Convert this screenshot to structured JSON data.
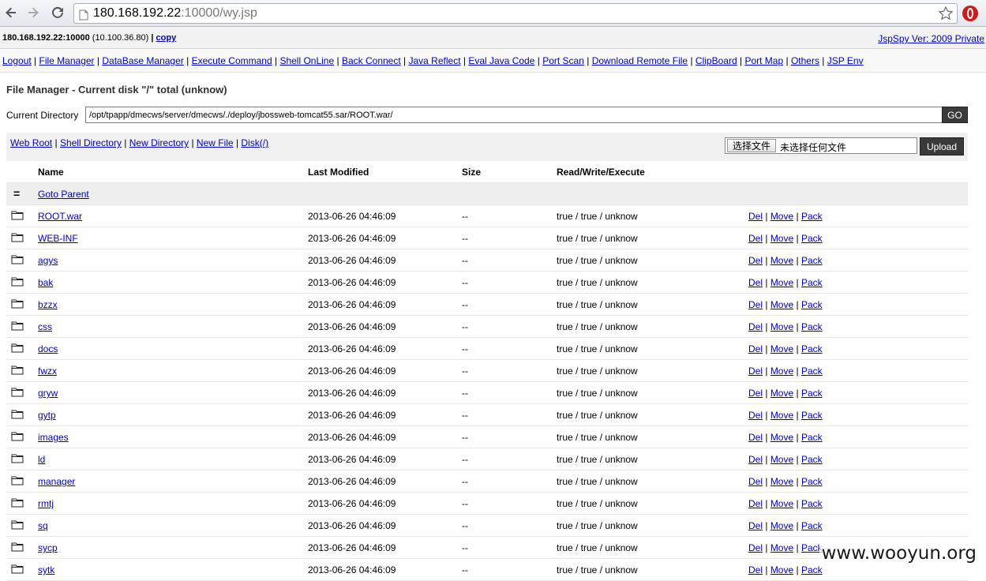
{
  "browser": {
    "url_host": "180.168.192.22",
    "url_rest": ":10000/wy.jsp"
  },
  "info": {
    "host": "180.168.192.22:10000",
    "local_ip": "(10.100.36.80)",
    "copy": "copy",
    "version": "JspSpy Ver: 2009 Private"
  },
  "menu": [
    "Logout",
    "File Manager",
    "DataBase Manager",
    "Execute Command",
    "Shell OnLine",
    "Back Connect",
    "Java Reflect",
    "Eval Java Code",
    "Port Scan",
    "Download Remote File",
    "ClipBoard",
    "Port Map",
    "Others",
    "JSP Env"
  ],
  "file_manager": {
    "title": "File Manager - Current disk \"/\" total (unknow)",
    "current_dir_label": "Current Directory",
    "current_dir_value": "/opt/tpapp/dmecws/server/dmecws/./deploy/jbossweb-tomcat55.sar/ROOT.war/",
    "go_label": "GO",
    "toolbar_links": [
      "Web Root",
      "Shell Directory",
      "New Directory",
      "New File",
      "Disk(/)"
    ],
    "choose_file_label": "选择文件",
    "no_file_label": "未选择任何文件",
    "upload_label": "Upload",
    "columns": {
      "name": "Name",
      "modified": "Last Modified",
      "size": "Size",
      "rwx": "Read/Write/Execute"
    },
    "parent_icon": "=",
    "goto_parent": "Goto Parent",
    "actions": [
      "Del",
      "Move",
      "Pack"
    ],
    "rows": [
      {
        "name": "ROOT.war",
        "modified": "2013-06-26 04:46:09",
        "size": "--",
        "rwx": "true / true / unknow"
      },
      {
        "name": "WEB-INF",
        "modified": "2013-06-26 04:46:09",
        "size": "--",
        "rwx": "true / true / unknow"
      },
      {
        "name": "agys",
        "modified": "2013-06-26 04:46:09",
        "size": "--",
        "rwx": "true / true / unknow"
      },
      {
        "name": "bak",
        "modified": "2013-06-26 04:46:09",
        "size": "--",
        "rwx": "true / true / unknow"
      },
      {
        "name": "bzzx",
        "modified": "2013-06-26 04:46:09",
        "size": "--",
        "rwx": "true / true / unknow"
      },
      {
        "name": "css",
        "modified": "2013-06-26 04:46:09",
        "size": "--",
        "rwx": "true / true / unknow"
      },
      {
        "name": "docs",
        "modified": "2013-06-26 04:46:09",
        "size": "--",
        "rwx": "true / true / unknow"
      },
      {
        "name": "fwzx",
        "modified": "2013-06-26 04:46:09",
        "size": "--",
        "rwx": "true / true / unknow"
      },
      {
        "name": "gryw",
        "modified": "2013-06-26 04:46:09",
        "size": "--",
        "rwx": "true / true / unknow"
      },
      {
        "name": "gytp",
        "modified": "2013-06-26 04:46:09",
        "size": "--",
        "rwx": "true / true / unknow"
      },
      {
        "name": "images",
        "modified": "2013-06-26 04:46:09",
        "size": "--",
        "rwx": "true / true / unknow"
      },
      {
        "name": "ld",
        "modified": "2013-06-26 04:46:09",
        "size": "--",
        "rwx": "true / true / unknow"
      },
      {
        "name": "manager",
        "modified": "2013-06-26 04:46:09",
        "size": "--",
        "rwx": "true / true / unknow"
      },
      {
        "name": "rmtj",
        "modified": "2013-06-26 04:46:09",
        "size": "--",
        "rwx": "true / true / unknow"
      },
      {
        "name": "sq",
        "modified": "2013-06-26 04:46:09",
        "size": "--",
        "rwx": "true / true / unknow"
      },
      {
        "name": "sycp",
        "modified": "2013-06-26 04:46:09",
        "size": "--",
        "rwx": "true / true / unknow"
      },
      {
        "name": "sytk",
        "modified": "2013-06-26 04:46:09",
        "size": "--",
        "rwx": "true / true / unknow"
      }
    ]
  },
  "watermark": "www.wooyun.org",
  "colors": {
    "link": "#0000cc",
    "button_dark": "#3a3a3a",
    "opera_red": "#cc1b1b"
  },
  "icons": {
    "back": "back-arrow-icon",
    "forward": "forward-arrow-icon",
    "reload": "reload-icon",
    "page": "page-icon",
    "star": "star-icon",
    "opera": "opera-icon",
    "folder": "folder-icon"
  }
}
